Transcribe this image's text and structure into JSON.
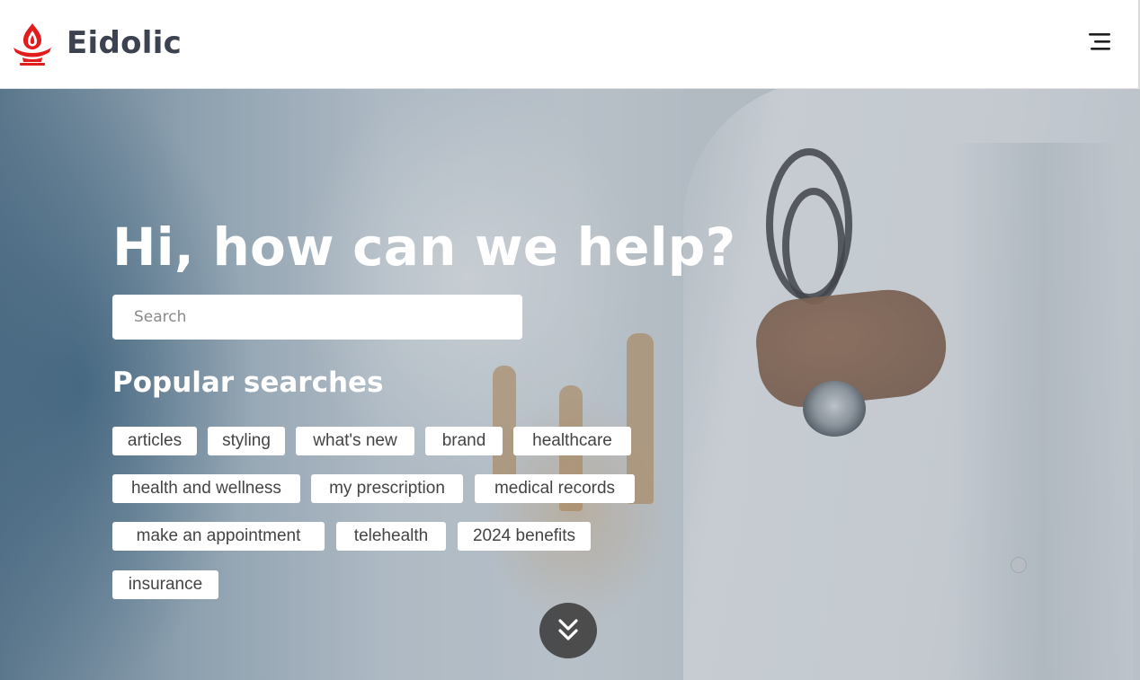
{
  "header": {
    "brand": "Eidolic",
    "logo_icon": "flame-lamp-icon",
    "logo_color": "#e11d1d",
    "menu_icon": "hamburger-menu-icon"
  },
  "hero": {
    "title": "Hi, how can we help?",
    "search": {
      "placeholder": "Search",
      "value": ""
    },
    "popular_title": "Popular searches",
    "popular_searches": [
      "articles",
      "styling",
      "what's new",
      "brand",
      "healthcare",
      "health and wellness",
      "my prescription",
      "medical records",
      "make an appointment",
      "telehealth",
      "2024 benefits",
      "insurance"
    ],
    "scroll_icon": "double-chevron-down-icon"
  },
  "colors": {
    "title_text": "#ffffff",
    "brand_text": "#3d4250",
    "chip_background": "#ffffff",
    "chip_text": "#444444",
    "scroll_button": "#424242"
  }
}
